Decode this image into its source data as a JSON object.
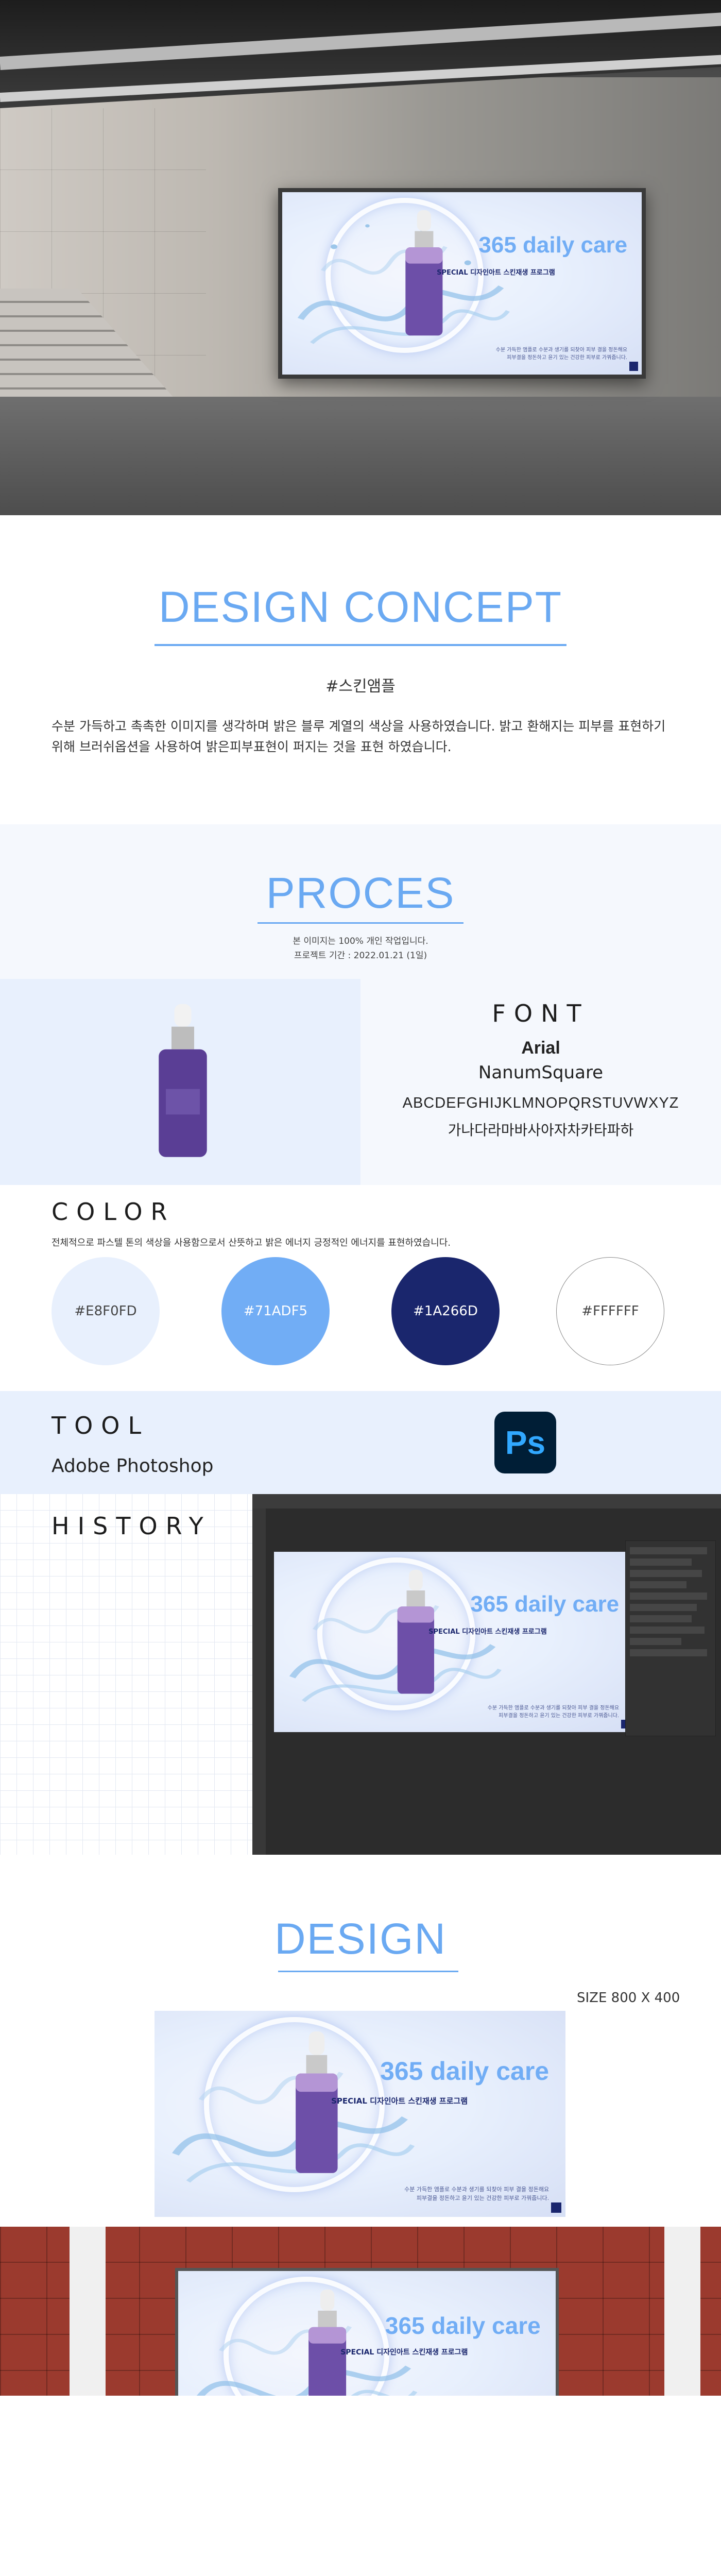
{
  "ad": {
    "title": "365 daily care",
    "subtitle_prefix": "SPECIAL 디자인아트 ",
    "subtitle_highlight": "스킨재생 프로그램",
    "desc_line1": "수분 가득한 앰플로 수분과 생기를 되찾아 피부 결을 정돈해요",
    "desc_line2": "피부결을 정돈하고 윤기 있는 건강한 피부로 가꿔줍니다."
  },
  "concept": {
    "heading": "DESIGN CONCEPT",
    "tag": "#스킨앰플",
    "body": "수분 가득하고 촉촉한 이미지를 생각하며 밝은 블루 계열의 색상을 사용하였습니다. 밝고 환해지는 피부를 표현하기 위해 브러쉬옵션을 사용하여 밝은피부표현이 퍼지는 것을 표현 하였습니다."
  },
  "process": {
    "heading": "PROCES",
    "note1": "본 이미지는 100% 개인 작업입니다.",
    "note2": "프로젝트 기간 : 2022.01.21 (1일)"
  },
  "font": {
    "heading": "FONT",
    "primary": "Arial",
    "secondary": "NanumSquare",
    "latin_sample": "ABCDEFGHIJKLMNOPQRSTUVWXYZ",
    "korean_sample": "가나다라마바사아자차카타파하"
  },
  "color": {
    "heading": "COLOR",
    "desc": "전체적으로 파스텔 톤의 색상을 사용함으로서 산뜻하고 밝은 에너지 긍정적인 에너지를 표현하였습니다.",
    "swatches": [
      {
        "hex": "#E8F0FD",
        "label": "#E8F0FD"
      },
      {
        "hex": "#71ADF5",
        "label": "#71ADF5"
      },
      {
        "hex": "#1A266D",
        "label": "#1A266D"
      },
      {
        "hex": "#FFFFFF",
        "label": "#FFFFFF"
      }
    ]
  },
  "tool": {
    "heading": "TOOL",
    "name": "Adobe Photoshop",
    "icon_text": "Ps"
  },
  "history": {
    "heading": "HISTORY"
  },
  "design": {
    "heading": "DESIGN",
    "size": "SIZE 800 X 400"
  }
}
